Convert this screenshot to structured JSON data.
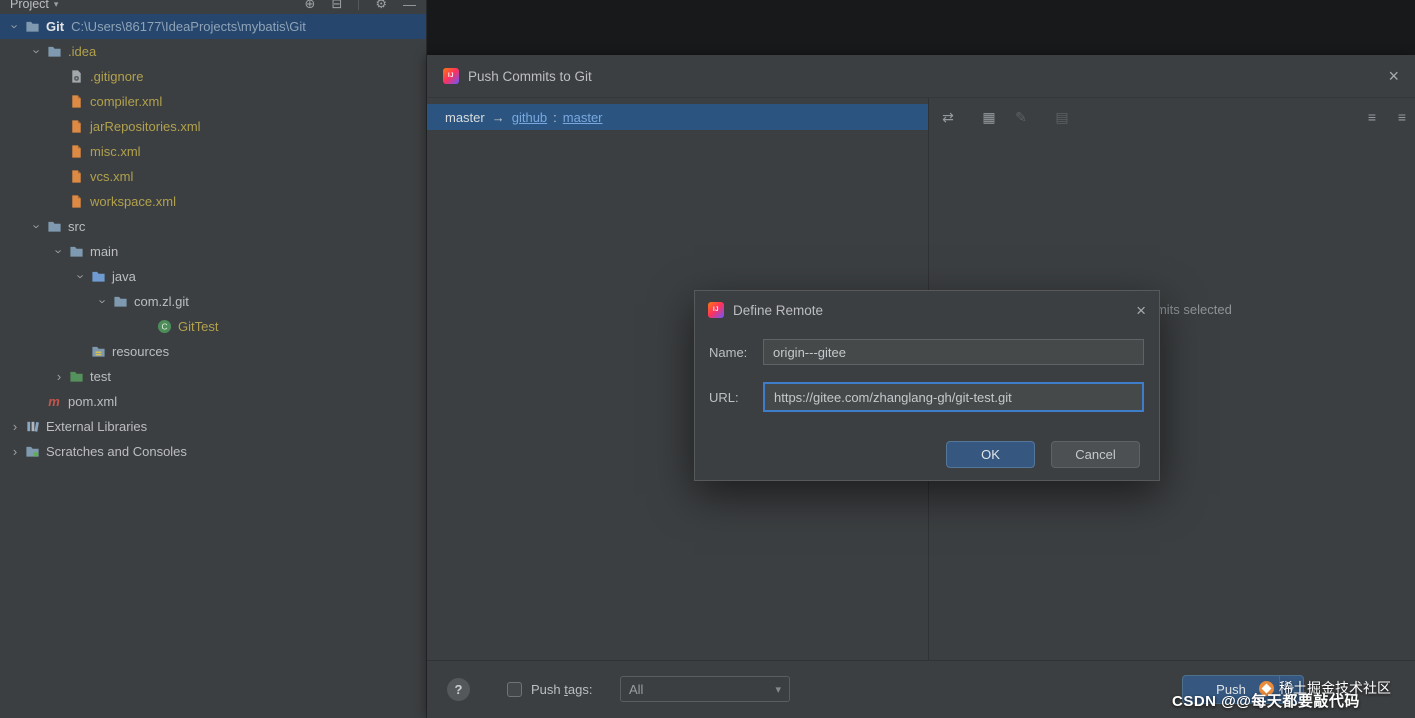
{
  "project_panel": {
    "header": {
      "title": "Project"
    },
    "tree": {
      "root": {
        "name": "Git",
        "path": "C:\\Users\\86177\\IdeaProjects\\mybatis\\Git"
      },
      "items": [
        {
          "label": ".idea"
        },
        {
          "label": ".gitignore"
        },
        {
          "label": "compiler.xml"
        },
        {
          "label": "jarRepositories.xml"
        },
        {
          "label": "misc.xml"
        },
        {
          "label": "vcs.xml"
        },
        {
          "label": "workspace.xml"
        },
        {
          "label": "src"
        },
        {
          "label": "main"
        },
        {
          "label": "java"
        },
        {
          "label": "com.zl.git"
        },
        {
          "label": "GitTest"
        },
        {
          "label": "resources"
        },
        {
          "label": "test"
        },
        {
          "label": "pom.xml"
        },
        {
          "label": "External Libraries"
        },
        {
          "label": "Scratches and Consoles"
        }
      ]
    }
  },
  "push_dialog": {
    "title": "Push Commits to Git",
    "commit": {
      "local": "master",
      "arrow": "→",
      "remote": "github",
      "sep": ":",
      "branch": "master"
    },
    "empty_message": "No commits selected",
    "footer": {
      "push_tags_1": "Push ",
      "push_tags_2": "t",
      "push_tags_3": "ags:",
      "tags_value": "All",
      "push_button": "Push"
    }
  },
  "define_remote_dialog": {
    "title": "Define Remote",
    "name_label": "Name:",
    "name_value": "origin---gitee",
    "url_label": "URL:",
    "url_value": "https://gitee.com/zhanglang-gh/git-test.git",
    "ok_label": "OK",
    "cancel_label": "Cancel"
  },
  "watermark": {
    "juejin_text": "稀土掘金技术社区",
    "csdn_text": "CSDN @@每天都要敲代码"
  },
  "icons": {
    "close": "×",
    "help": "?",
    "chevron": "›",
    "project_caret": "▾",
    "combo_arrow": "▾",
    "push_arrow": "▾",
    "locate": "⊕",
    "collapse_all": "⊟",
    "settings": "⚙",
    "hide": "—",
    "compare": "⇄",
    "details_grid": "▦",
    "edit": "✎",
    "annotate": "▤",
    "expand_list": "≡",
    "collapse_list": "≡"
  },
  "colors": {
    "panel_bg": "#3c3f41",
    "editor_bg": "#18191b",
    "tree_selection": "#26466d",
    "commit_selection": "#2b5580",
    "primary_button": "#365880",
    "focus_border": "#3d7dca",
    "link": "#79a8e0",
    "ignored_file_text": "#b1a14e"
  }
}
